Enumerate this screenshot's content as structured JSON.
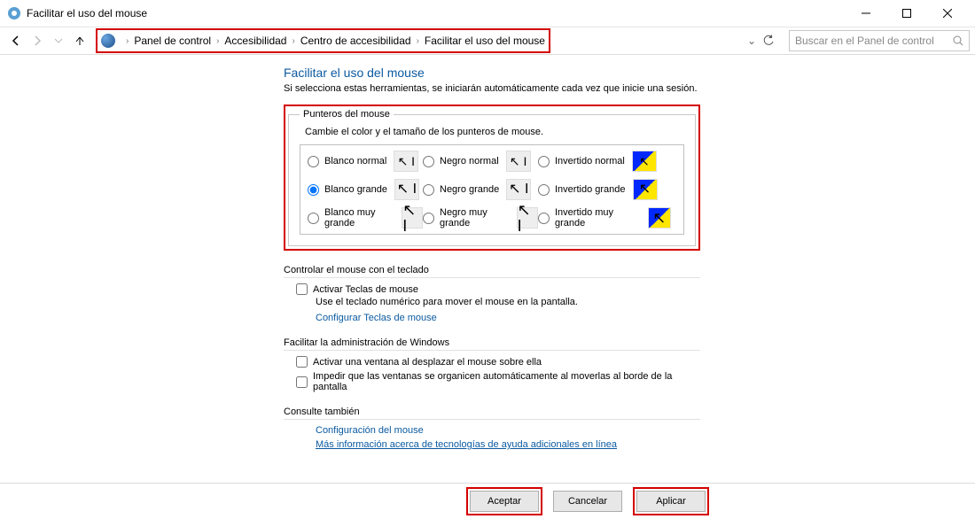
{
  "window": {
    "title": "Facilitar el uso del mouse"
  },
  "breadcrumb": {
    "items": [
      "Panel de control",
      "Accesibilidad",
      "Centro de accesibilidad",
      "Facilitar el uso del mouse"
    ]
  },
  "search": {
    "placeholder": "Buscar en el Panel de control"
  },
  "heading": "Facilitar el uso del mouse",
  "subtitle": "Si selecciona estas herramientas, se iniciarán automáticamente cada vez que inicie una sesión.",
  "pointers": {
    "legend": "Punteros del mouse",
    "desc": "Cambie el color y el tamaño de los punteros de mouse.",
    "options": [
      {
        "id": "white-normal",
        "label": "Blanco normal"
      },
      {
        "id": "black-normal",
        "label": "Negro normal"
      },
      {
        "id": "inv-normal",
        "label": "Invertido normal"
      },
      {
        "id": "white-large",
        "label": "Blanco grande"
      },
      {
        "id": "black-large",
        "label": "Negro grande"
      },
      {
        "id": "inv-large",
        "label": "Invertido grande"
      },
      {
        "id": "white-xl",
        "label": "Blanco muy grande"
      },
      {
        "id": "black-xl",
        "label": "Negro muy grande"
      },
      {
        "id": "inv-xl",
        "label": "Invertido muy grande"
      }
    ],
    "selected": "white-large"
  },
  "keyboard": {
    "title": "Controlar el mouse con el teclado",
    "mousekeys": "Activar Teclas de mouse",
    "hint": "Use el teclado numérico para mover el mouse en la pantalla.",
    "link": "Configurar Teclas de mouse"
  },
  "admin": {
    "title": "Facilitar la administración de Windows",
    "opt1": "Activar una ventana al desplazar el mouse sobre ella",
    "opt2": "Impedir que las ventanas se organicen automáticamente al moverlas al borde de la pantalla"
  },
  "seealso": {
    "title": "Consulte también",
    "link1": "Configuración del mouse",
    "link2": "Más información acerca de tecnologías de ayuda adicionales en línea"
  },
  "buttons": {
    "ok": "Aceptar",
    "cancel": "Cancelar",
    "apply": "Aplicar"
  }
}
